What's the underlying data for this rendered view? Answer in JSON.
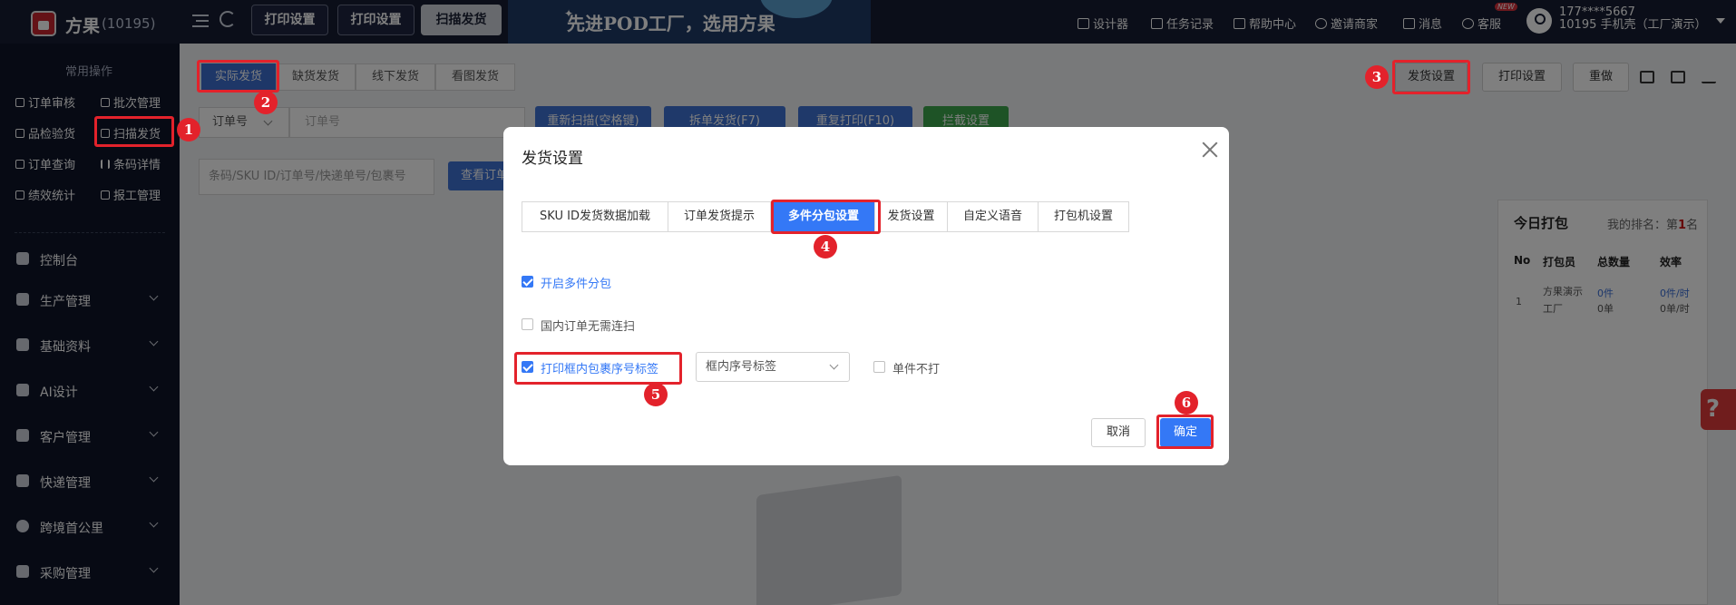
{
  "topbar": {
    "brand": "方果",
    "brand_count": "(10195)",
    "tabs": [
      "打印设置",
      "打印设置",
      "扫描发货"
    ],
    "slogan": "先进POD工厂，选用方果",
    "nav": [
      "设计器",
      "任务记录",
      "帮助中心",
      "邀请商家",
      "消息",
      "客服"
    ],
    "new_badge": "NEW",
    "user_phone": "177****5667",
    "user_account": "10195 手机壳（工厂演示）"
  },
  "sidebar": {
    "section_title": "常用操作",
    "quick_ops": [
      "订单审核",
      "批次管理",
      "品检验货",
      "扫描发货",
      "订单查询",
      "条码详情",
      "绩效统计",
      "报工管理"
    ],
    "menu": [
      "控制台",
      "生产管理",
      "基础资料",
      "AI设计",
      "客户管理",
      "快递管理",
      "跨境首公里",
      "采购管理"
    ]
  },
  "main": {
    "subtabs": [
      "实际发货",
      "缺货发货",
      "线下发货",
      "看图发货"
    ],
    "right_buttons": [
      "发货设置",
      "打印设置",
      "重做"
    ],
    "order_type": "订单号",
    "order_placeholder": "订单号",
    "actions": [
      "重新扫描(空格键)",
      "拆单发货(F7)",
      "重复打印(F10)",
      "拦截设置"
    ],
    "barcode_placeholder": "条码/SKU ID/订单号/快递单号/包裹号",
    "view_button": "查看订单"
  },
  "panel": {
    "title": "今日打包",
    "rank_label": "我的排名：第",
    "rank_value": "1",
    "rank_suffix": "名",
    "headers": [
      "No",
      "打包员",
      "总数量",
      "效率"
    ],
    "row": {
      "no": "1",
      "packer_line1": "方果演示",
      "packer_line2": "工厂",
      "qty1": "0件",
      "qty2": "0单",
      "rate1": "0件/时",
      "rate2": "0单/时"
    }
  },
  "help": "?",
  "modal": {
    "title": "发货设置",
    "tabs": [
      "SKU ID发货数据加载",
      "订单发货提示",
      "多件分包设置",
      "发货设置",
      "自定义语音",
      "打包机设置"
    ],
    "active_tab": 2,
    "options": [
      {
        "label": "开启多件分包",
        "checked": true
      },
      {
        "label": "国内订单无需连扫",
        "checked": false
      },
      {
        "label": "打印框内包裹序号标签",
        "checked": true
      }
    ],
    "select_value": "框内序号标签",
    "single_label": "单件不打",
    "cancel": "取消",
    "confirm": "确定"
  },
  "annotations": [
    "1",
    "2",
    "3",
    "4",
    "5",
    "6"
  ],
  "colors": {
    "primary": "#3478f6",
    "highlight": "#e3222b",
    "sidebar": "#0e1529",
    "topbar": "#161d33"
  }
}
